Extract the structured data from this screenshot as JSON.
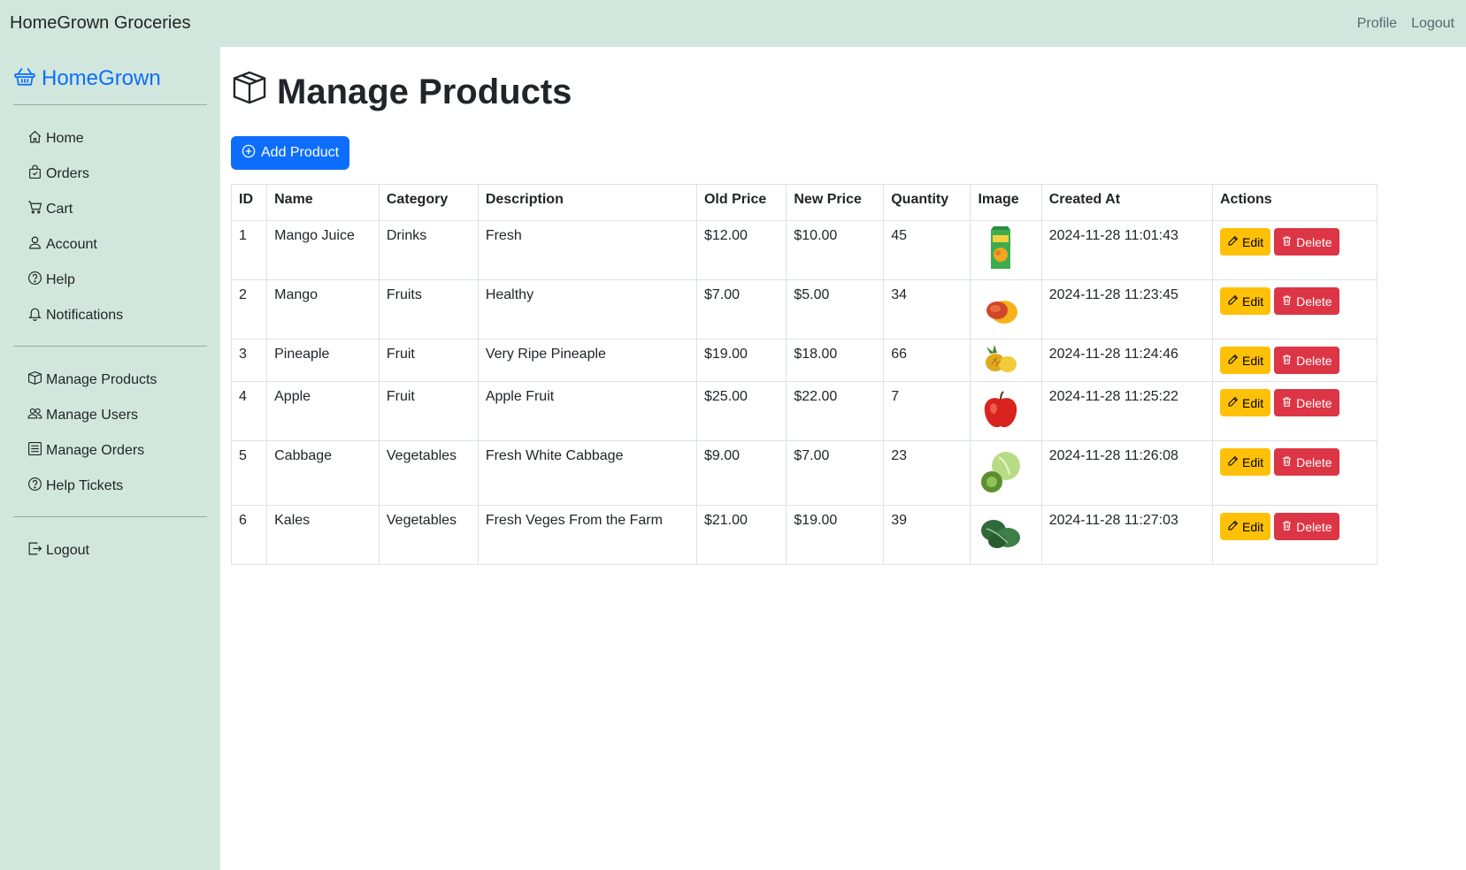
{
  "topbar": {
    "brand": "HomeGrown Groceries",
    "links": [
      "Profile",
      "Logout"
    ]
  },
  "sidebar": {
    "brand": "HomeGrown",
    "group1": [
      {
        "label": "Home",
        "icon": "home-icon"
      },
      {
        "label": "Orders",
        "icon": "bag-icon"
      },
      {
        "label": "Cart",
        "icon": "cart-icon"
      },
      {
        "label": "Account",
        "icon": "person-icon"
      },
      {
        "label": "Help",
        "icon": "question-circle-icon"
      },
      {
        "label": "Notifications",
        "icon": "bell-icon"
      }
    ],
    "group2": [
      {
        "label": "Manage Products",
        "icon": "box-icon"
      },
      {
        "label": "Manage Users",
        "icon": "people-icon"
      },
      {
        "label": "Manage Orders",
        "icon": "list-icon"
      },
      {
        "label": "Help Tickets",
        "icon": "question-circle-icon"
      }
    ],
    "group3": [
      {
        "label": "Logout",
        "icon": "logout-icon"
      }
    ]
  },
  "main": {
    "title": "Manage Products",
    "add_button": "Add Product",
    "table": {
      "headers": [
        "ID",
        "Name",
        "Category",
        "Description",
        "Old Price",
        "New Price",
        "Quantity",
        "Image",
        "Created At",
        "Actions"
      ],
      "edit_label": "Edit",
      "delete_label": "Delete",
      "rows": [
        {
          "id": "1",
          "name": "Mango Juice",
          "category": "Drinks",
          "description": "Fresh",
          "old_price": "$12.00",
          "new_price": "$10.00",
          "quantity": "45",
          "image": "juice-box",
          "created_at": "2024-11-28 11:01:43"
        },
        {
          "id": "2",
          "name": "Mango",
          "category": "Fruits",
          "description": "Healthy",
          "old_price": "$7.00",
          "new_price": "$5.00",
          "quantity": "34",
          "image": "mango",
          "created_at": "2024-11-28 11:23:45"
        },
        {
          "id": "3",
          "name": "Pineaple",
          "category": "Fruit",
          "description": "Very Ripe Pineaple",
          "old_price": "$19.00",
          "new_price": "$18.00",
          "quantity": "66",
          "image": "pineapple",
          "created_at": "2024-11-28 11:24:46"
        },
        {
          "id": "4",
          "name": "Apple",
          "category": "Fruit",
          "description": "Apple Fruit",
          "old_price": "$25.00",
          "new_price": "$22.00",
          "quantity": "7",
          "image": "apple",
          "created_at": "2024-11-28 11:25:22"
        },
        {
          "id": "5",
          "name": "Cabbage",
          "category": "Vegetables",
          "description": "Fresh White Cabbage",
          "old_price": "$9.00",
          "new_price": "$7.00",
          "quantity": "23",
          "image": "cabbage",
          "created_at": "2024-11-28 11:26:08"
        },
        {
          "id": "6",
          "name": "Kales",
          "category": "Vegetables",
          "description": "Fresh Veges From the Farm",
          "old_price": "$21.00",
          "new_price": "$19.00",
          "quantity": "39",
          "image": "kale",
          "created_at": "2024-11-28 11:27:03"
        }
      ]
    }
  },
  "colors": {
    "sidebar_bg": "#d1e7dd",
    "primary": "#0d6efd",
    "warning": "#ffc107",
    "danger": "#dc3545"
  }
}
